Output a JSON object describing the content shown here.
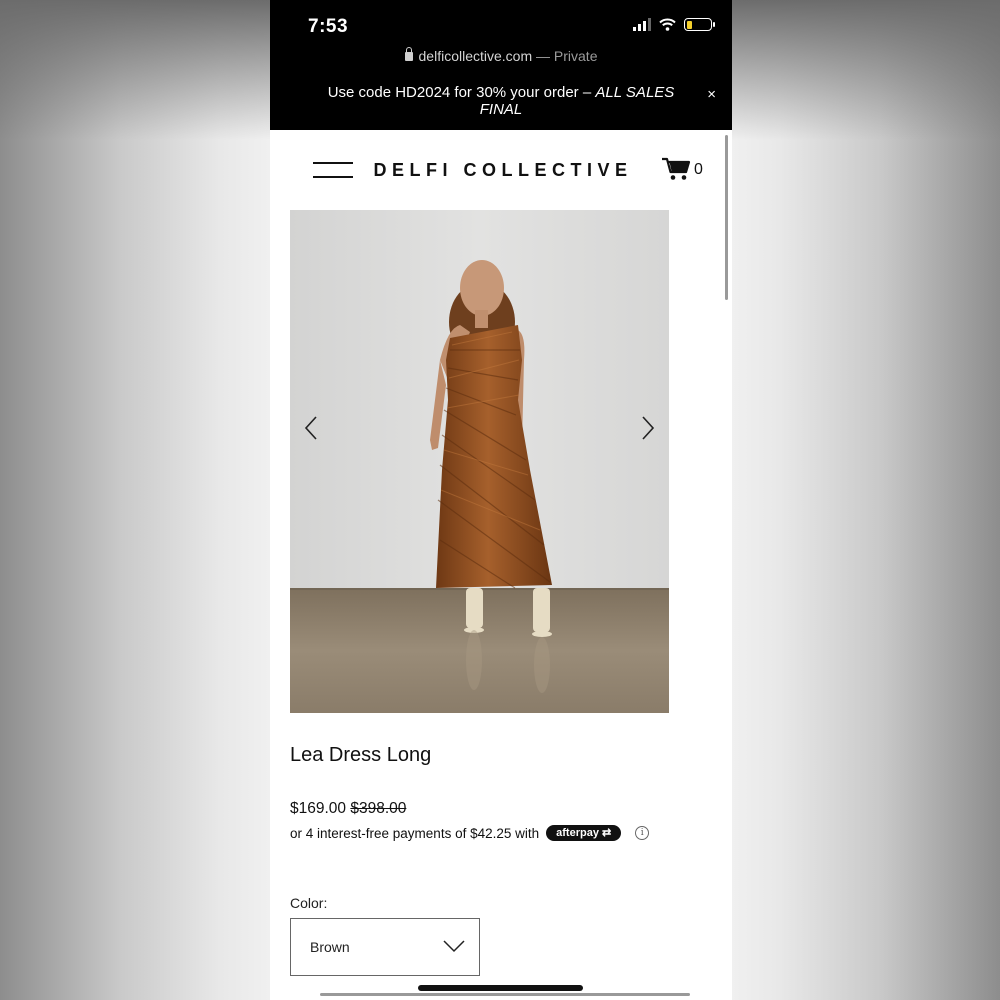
{
  "status_bar": {
    "time": "7:53",
    "icons": [
      "cellular-signal-icon",
      "wifi-icon",
      "battery-icon"
    ],
    "battery_color": "#f5d02c"
  },
  "browser": {
    "url": "delficollective.com",
    "mode": "— Private"
  },
  "promo": {
    "text": "Use code HD2024 for 30% your order – ",
    "emphasis": "ALL SALES FINAL",
    "close_label": "×"
  },
  "header": {
    "brand": "DELFI COLLECTIVE",
    "cart_count": "0"
  },
  "product": {
    "title": "Lea Dress Long",
    "price": "$169.00",
    "original_price": "$398.00",
    "installments_text": "or 4 interest-free payments of $42.25 with",
    "afterpay_label": "afterpay",
    "info_label": "i",
    "color_label": "Color:",
    "color_value": "Brown"
  },
  "colors": {
    "dress": "#8a4a1e",
    "wall": "#dcdcdb",
    "floor": "#8c7e6b",
    "topbar": "#000000"
  }
}
